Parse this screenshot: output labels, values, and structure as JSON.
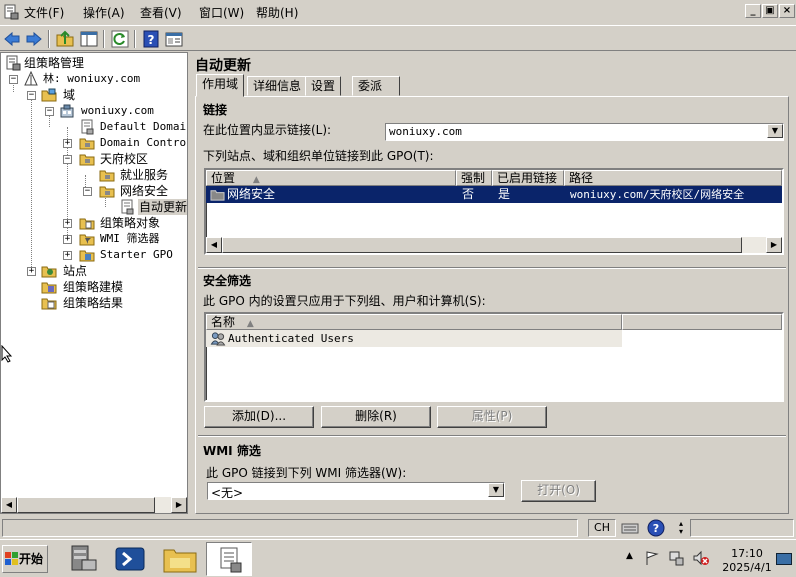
{
  "menu": {
    "items": [
      "文件(F)",
      "操作(A)",
      "查看(V)",
      "窗口(W)",
      "帮助(H)"
    ],
    "window_buttons": [
      "_",
      "▣",
      "×"
    ]
  },
  "toolbar": {
    "buttons": [
      "back-icon",
      "forward-icon",
      "up-folder-icon",
      "show-tree-icon",
      "refresh-icon",
      "help-icon",
      "properties-icon"
    ]
  },
  "tree": {
    "root": "组策略管理",
    "forest": "林: woniuxy.com",
    "domains": "域",
    "domain": "woniuxy.com",
    "default_domain": "Default Domain",
    "domain_control": "Domain Control",
    "tianfu": "天府校区",
    "jiuye": "就业服务",
    "network_security": "网络安全",
    "auto_update": "自动更新",
    "gpo_objects": "组策略对象",
    "wmi_filters": "WMI 筛选器",
    "starter_gpo": "Starter GPO",
    "sites": "站点",
    "modeling": "组策略建模",
    "results": "组策略结果"
  },
  "right": {
    "title": "自动更新",
    "tabs": [
      "作用域",
      "详细信息",
      "设置",
      "委派"
    ],
    "links": {
      "heading": "链接",
      "display_label": "在此位置内显示链接(L):",
      "display_value": "woniuxy.com",
      "list_label": "下列站点、域和组织单位链接到此 GPO(T):",
      "columns": [
        "位置",
        "强制",
        "已启用链接",
        "路径"
      ],
      "rows": [
        {
          "location": "网络安全",
          "enforced": "否",
          "enabled": "是",
          "path": "woniuxy.com/天府校区/网络安全"
        }
      ]
    },
    "security": {
      "heading": "安全筛选",
      "desc": "此 GPO 内的设置只应用于下列组、用户和计算机(S):",
      "columns": [
        "名称"
      ],
      "rows": [
        "Authenticated Users"
      ],
      "add": "添加(D)...",
      "remove": "删除(R)",
      "properties": "属性(P)"
    },
    "wmi": {
      "heading": "WMI 筛选",
      "desc": "此 GPO 链接到下列 WMI 筛选器(W):",
      "value": "<无>",
      "open": "打开(O)"
    }
  },
  "status": {
    "lang": "CH"
  },
  "taskbar": {
    "start": "开始",
    "time": "17:10",
    "date": "2025/4/1"
  },
  "colors": {
    "selection": "#0a246a",
    "face": "#d4d0c8",
    "folder": "#e8c050"
  }
}
